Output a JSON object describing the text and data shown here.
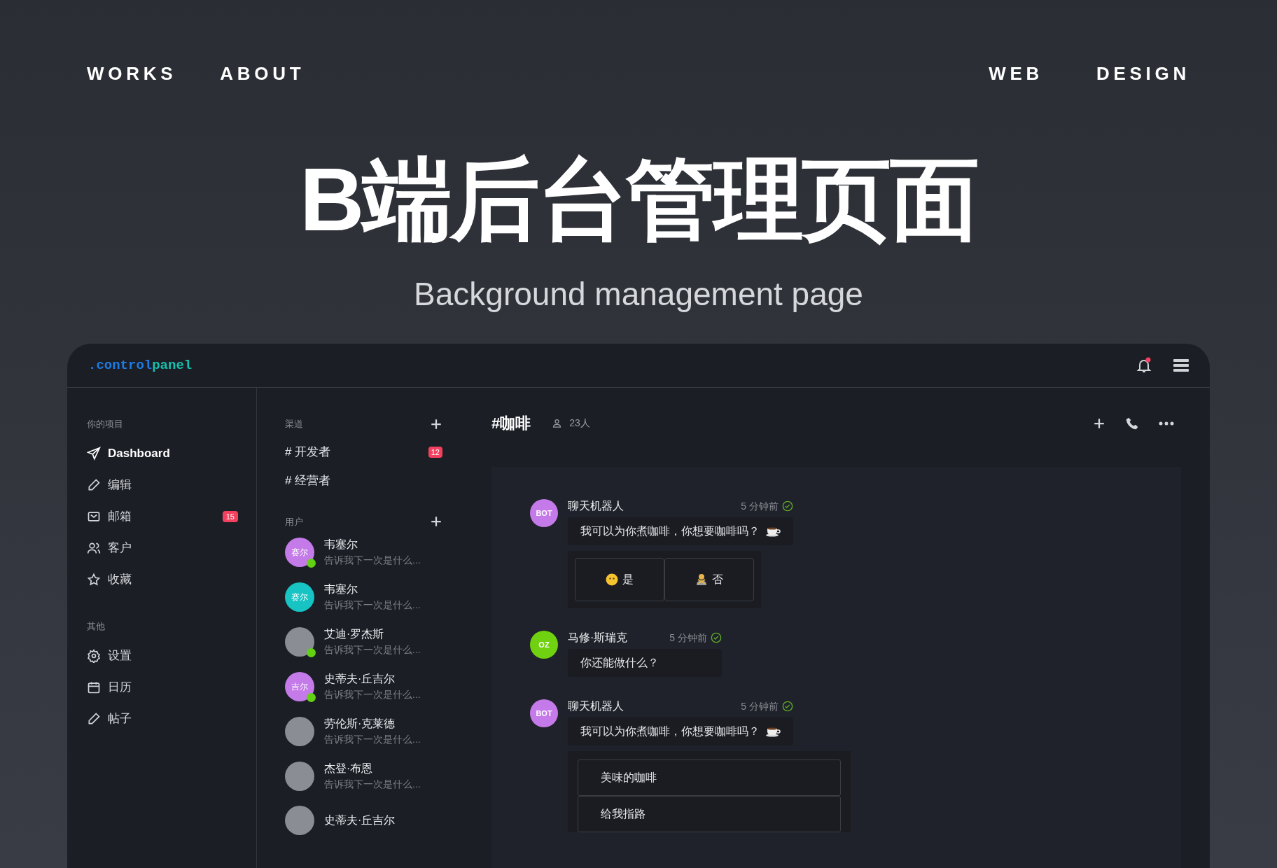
{
  "nav": {
    "left": [
      "WORKS",
      "ABOUT"
    ],
    "right": [
      "WEB",
      "DESIGN"
    ]
  },
  "hero": {
    "title": "B端后台管理页面",
    "subtitle": "Background management page"
  },
  "app": {
    "logo": {
      "prefix": ".control",
      "suffix": "panel"
    },
    "notifications": true,
    "sidebar": [
      {
        "heading": "你的项目",
        "items": [
          {
            "label": "Dashboard",
            "selected": true
          },
          {
            "label": "编辑",
            "selected": false
          },
          {
            "label": "邮箱",
            "selected": false,
            "badge": "15"
          },
          {
            "label": "客户",
            "selected": false
          },
          {
            "label": "收藏",
            "selected": false
          }
        ]
      },
      {
        "heading": "其他",
        "items": [
          {
            "label": "设置",
            "selected": false
          },
          {
            "label": "日历",
            "selected": false
          },
          {
            "label": "帖子",
            "selected": false
          }
        ]
      }
    ],
    "channels": {
      "heading": "渠道",
      "items": [
        {
          "label": "# 开发者",
          "badge": "12"
        },
        {
          "label": "# 经营者"
        }
      ]
    },
    "users": {
      "heading": "用户",
      "items": [
        {
          "name": "韦塞尔",
          "preview": "告诉我下一次是什么...",
          "avatar": {
            "kind": "initials",
            "text": "赛尔",
            "color": "#c47ae8"
          },
          "online": true
        },
        {
          "name": "韦塞尔",
          "preview": "告诉我下一次是什么...",
          "avatar": {
            "kind": "initials",
            "text": "赛尔",
            "color": "#17c3c3"
          },
          "online": false
        },
        {
          "name": "艾迪·罗杰斯",
          "preview": "告诉我下一次是什么...",
          "avatar": {
            "kind": "photo"
          },
          "online": true
        },
        {
          "name": "史蒂夫·丘吉尔",
          "preview": "告诉我下一次是什么...",
          "avatar": {
            "kind": "initials",
            "text": "吉尔",
            "color": "#c47ae8"
          },
          "online": true
        },
        {
          "name": "劳伦斯·克莱德",
          "preview": "告诉我下一次是什么...",
          "avatar": {
            "kind": "photo"
          },
          "online": false
        },
        {
          "name": "杰登·布恩",
          "preview": "告诉我下一次是什么...",
          "avatar": {
            "kind": "photo"
          },
          "online": false
        },
        {
          "name": "史蒂夫·丘吉尔",
          "avatar": {
            "kind": "photo"
          },
          "online": false
        }
      ]
    },
    "chat": {
      "channel": "#咖啡",
      "members": "23人",
      "messages": [
        {
          "sender": "聊天机器人",
          "avatar": {
            "text": "BOT",
            "color": "#c47ae8"
          },
          "time": "5 分钟前",
          "delivered": true,
          "text": "我可以为你煮咖啡，你想要咖啡吗？",
          "coffee": true,
          "attachment": {
            "kind": "buttons",
            "items": [
              "是",
              "否"
            ]
          }
        },
        {
          "sender": "马修·斯瑞克",
          "avatar": {
            "text": "OZ",
            "color": "#6fd10f"
          },
          "time": "5 分钟前",
          "delivered": true,
          "text": "你还能做什么？",
          "coffee": false
        },
        {
          "sender": "聊天机器人",
          "avatar": {
            "text": "BOT",
            "color": "#c47ae8"
          },
          "time": "5 分钟前",
          "delivered": true,
          "text": "我可以为你煮咖啡，你想要咖啡吗？",
          "coffee": true,
          "attachment": {
            "kind": "options",
            "items": [
              "美味的咖啡",
              "给我指路"
            ]
          }
        }
      ]
    }
  }
}
